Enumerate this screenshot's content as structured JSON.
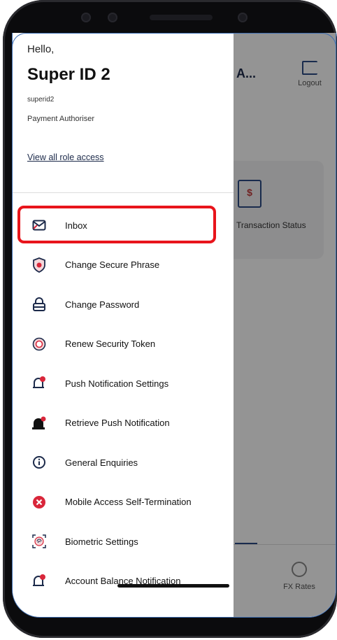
{
  "background": {
    "name_partial": "A...",
    "logout_label": "Logout",
    "card_label": "Transaction Status",
    "fx_label": "FX Rates"
  },
  "drawer": {
    "greeting": "Hello,",
    "user_name": "Super ID 2",
    "user_id": "superid2",
    "role": "Payment Authoriser",
    "role_link": "View all role access",
    "items": [
      {
        "label": "Inbox",
        "icon": "mail-icon"
      },
      {
        "label": "Change Secure Phrase",
        "icon": "shield-icon"
      },
      {
        "label": "Change Password",
        "icon": "lock-icon"
      },
      {
        "label": "Renew Security Token",
        "icon": "token-icon"
      },
      {
        "label": "Push Notification Settings",
        "icon": "bell-settings-icon"
      },
      {
        "label": "Retrieve Push Notification",
        "icon": "bell-icon"
      },
      {
        "label": "General Enquiries",
        "icon": "info-icon"
      },
      {
        "label": "Mobile Access Self-Termination",
        "icon": "close-circle-icon"
      },
      {
        "label": "Biometric Settings",
        "icon": "fingerprint-icon"
      },
      {
        "label": "Account Balance Notification",
        "icon": "bell-balance-icon"
      }
    ]
  },
  "colors": {
    "highlight": "#e8141b",
    "brand_navy": "#1c2a4a",
    "alert_red": "#d9263a"
  }
}
